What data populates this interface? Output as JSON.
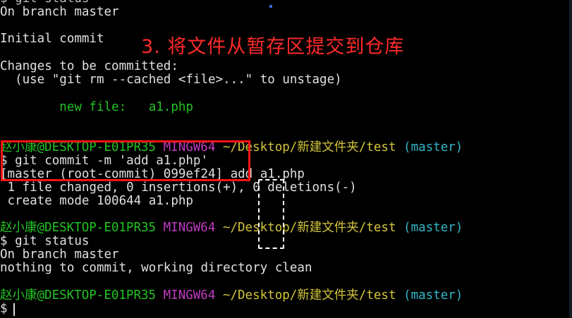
{
  "terminal": {
    "cut_top": "$ git status",
    "lines": {
      "l1": "On branch master",
      "l2": "Initial commit",
      "l3": "Changes to be committed:",
      "l4": "  (use \"git rm --cached <file>...\" to unstage)",
      "l5_label": "        new file:   ",
      "l5_file": "a1.php",
      "l7": "$ git commit -m 'add a1.php'",
      "l8": "[master (root-commit) 099ef24] add a1.php",
      "l9": " 1 file changed, 0 insertions(+), 0 deletions(-)",
      "l10": " create mode 100644 a1.php",
      "l12": "$ git status",
      "l13": "On branch master",
      "l14": "nothing to commit, working directory clean",
      "l16": "$ "
    },
    "prompt": {
      "user": "赵小康@DESKTOP-E01PR35",
      "shell": "MINGW64",
      "path": "~/Desktop/新建文件夹/test",
      "branch": "(master)"
    }
  },
  "annotation": {
    "text": "3. 将文件从暂存区提交到仓库"
  },
  "colors": {
    "background": "#000000",
    "text": "#e0e0e0",
    "prompt_user": "#22c322",
    "prompt_shell": "#c03cc0",
    "prompt_path": "#d2c43a",
    "prompt_branch": "#30b8c8",
    "annotation": "#ff2a2a",
    "highlight_box": "#ff1414"
  }
}
